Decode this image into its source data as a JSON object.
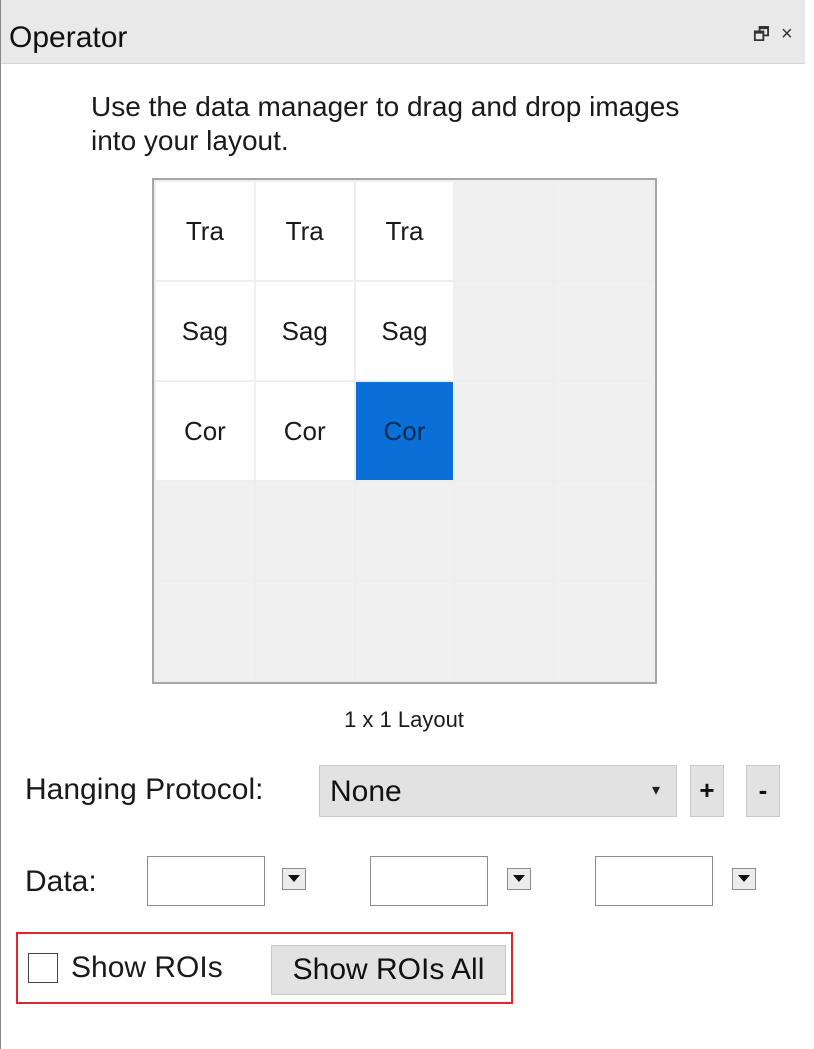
{
  "panel": {
    "title": "Operator",
    "float_icon": "restore-window-icon",
    "float_glyph": "🗗",
    "close_icon": "close-icon",
    "close_glyph": "×"
  },
  "instructions": "Use the data manager to drag and drop images into your layout.",
  "layout_grid": {
    "rows": [
      [
        "Tra",
        "Tra",
        "Tra",
        "",
        ""
      ],
      [
        "Sag",
        "Sag",
        "Sag",
        "",
        ""
      ],
      [
        "Cor",
        "Cor",
        "Cor",
        "",
        ""
      ],
      [
        "",
        "",
        "",
        "",
        ""
      ],
      [
        "",
        "",
        "",
        "",
        ""
      ]
    ],
    "selected_cell": [
      2,
      2
    ],
    "selected_color": "#0a6fd6",
    "label": "1 x 1 Layout"
  },
  "hanging_protocol": {
    "label": "Hanging Protocol:",
    "value": "None",
    "dropdown_arrow": "▾",
    "add_label": "+",
    "remove_label": "-"
  },
  "data_row": {
    "label": "Data:",
    "inputs": [
      "",
      "",
      ""
    ]
  },
  "rois": {
    "checkbox_label": "Show ROIs",
    "checked": false,
    "show_all_label": "Show ROIs All",
    "highlight_color": "#e0282c"
  }
}
